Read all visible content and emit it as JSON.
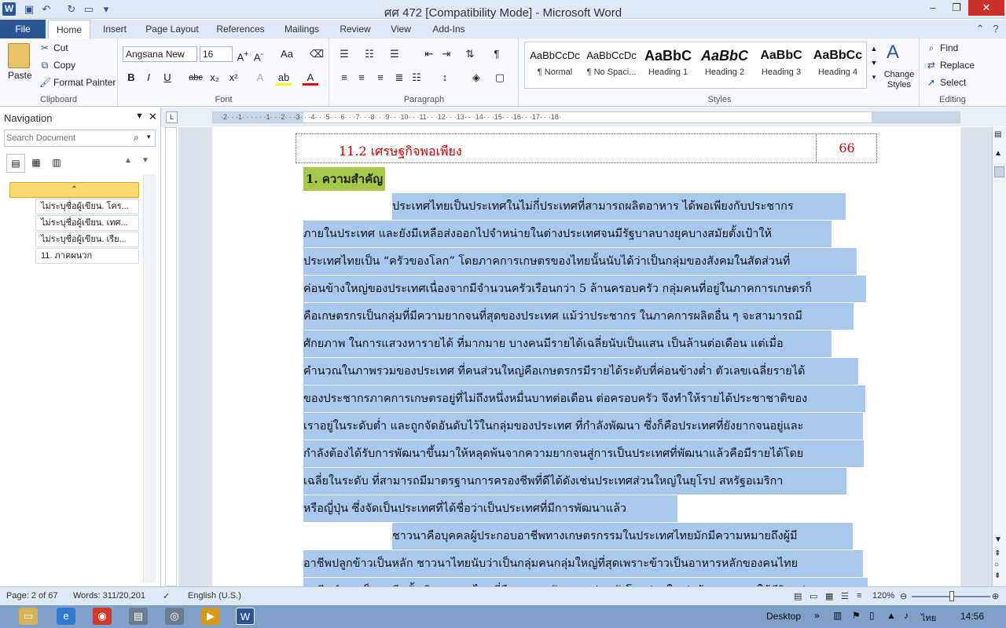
{
  "window": {
    "title": "ศศ 472 [Compatibility Mode]  -  Microsoft Word"
  },
  "tabs": {
    "file": "File",
    "items": [
      "Home",
      "Insert",
      "Page Layout",
      "References",
      "Mailings",
      "Review",
      "View",
      "Add-Ins"
    ]
  },
  "clipboard": {
    "paste": "Paste",
    "cut": "Cut",
    "copy": "Copy",
    "format_painter": "Format Painter",
    "label": "Clipboard"
  },
  "font": {
    "name": "Angsana New",
    "size": "16",
    "label": "Font"
  },
  "paragraph": {
    "label": "Paragraph"
  },
  "styles": {
    "label": "Styles",
    "change": "Change Styles",
    "items": [
      {
        "preview": "AaBbCcDc",
        "name": "¶ Normal"
      },
      {
        "preview": "AaBbCcDc",
        "name": "¶ No Spaci..."
      },
      {
        "preview": "AaBbC",
        "name": "Heading 1"
      },
      {
        "preview": "AaBbC",
        "name": "Heading 2"
      },
      {
        "preview": "AaBbC",
        "name": "Heading 3"
      },
      {
        "preview": "AaBbCc",
        "name": "Heading 4"
      }
    ]
  },
  "editing": {
    "label": "Editing",
    "find": "Find",
    "replace": "Replace",
    "select": "Select"
  },
  "nav": {
    "title": "Navigation",
    "search_placeholder": "Search Document",
    "items": [
      "ไม่ระบุชื่อผู้เขียน. โคร...",
      "ไม่ระบุชื่อผู้เขียน. เทศ...",
      "ไม่ระบุชื่อผู้เขียน. เรีย...",
      "11. ภาคผนวก"
    ]
  },
  "document": {
    "toc_entry": {
      "title": "11.2 เศรษฐกิจพอเพียง",
      "page": "66"
    },
    "heading": "1. ความสำคัญ",
    "lines": [
      "ประเทศไทยเป็นประเทศในไม่กี่ประเทศที่สามารถผลิตอาหาร ได้พอเพียงกับประชากร",
      "ภายในประเทศ และยังมีเหลือส่งออกไปจำหน่ายในต่างประเทศจนมีรัฐบาลบางยุคบางสมัยตั้งเป้าให้",
      "ประเทศไทยเป็น “ครัวของโลก”  โดยภาคการเกษตรของไทยนั้นนับได้ว่าเป็นกลุ่มของสังคมในสัดส่วนที่",
      "ค่อนข้างใหญ่ของประเทศเนื่องจากมีจำนวนครัวเรือนกว่า 5 ล้านครอบครัว กลุ่มคนที่อยู่ในภาคการเกษตรก็",
      "คือเกษตรกรเป็นกลุ่มที่มีความยากจนที่สุดของประเทศ แม้ว่าประชากร ในภาคการผลิตอื่น ๆ จะสามารถมี",
      "ศักยภาพ ในการแสวงหารายได้ ที่มากมาย บางคนมีรายได้เฉลี่ยนับเป็นแสน เป็นล้านต่อเดือน แต่เมื่อ",
      "คำนวณในภาพรวมของประเทศ ที่คนส่วนใหญ่คือเกษตรกรมีรายได้ระดับที่ค่อนข้างต่ำ ตัวเลขเฉลี่ยรายได้",
      "ของประชากรภาคการเกษตรอยู่ที่ไม่ถึงหนึ่งหมื่นบาทต่อเดือน ต่อครอบครัว จึงทำให้รายได้ประชาชาติของ",
      "เราอยู่ในระดับต่ำ และถูกจัดอันดับไว้ในกลุ่มของประเทศ ที่กำลังพัฒนา ซึ่งก็คือประเทศที่ยังยากจนอยู่และ",
      "กำลังต้องได้รับการพัฒนาขึ้นมาให้หลุดพ้นจากความยากจนสู่การเป็นประเทศที่พัฒนาแล้วคือมีรายได้โดย",
      "เฉลี่ยในระดับ ที่สามารถมีมาตรฐานการครองชีพที่ดีได้ดังเช่นประเทศส่วนใหญ่ในยุโรป สหรัฐอเมริกา",
      "หรือญี่ปุ่น ซึ่งจัดเป็นประเทศที่ได้ชื่อว่าเป็นประเทศที่มีการพัฒนาแล้ว",
      "ชาวนาคือบุคคลผู้ประกอบอาชีพทางเกษตรกรรมในประเทศไทยมักมีความหมายถึงผู้มี",
      "อาชีพปลูกข้าวเป็นหลัก ชาวนาไทยนับว่าเป็นกลุ่มคนกลุ่มใหญ่ที่สุดเพราะข้าวเป็นอาหารหลักของคนไทย",
      "อาชีพทำนาเป็นอาชีพดั้งเดิมของคนไทยที่สืบทอดมายังอนุชนรุ่นหลังโดยส่วนใหญ่แล้วชาวนาจะใช้ชีวิตอยู่"
    ]
  },
  "status": {
    "page": "Page: 2 of 67",
    "words": "Words: 311/20,201",
    "language": "English (U.S.)",
    "zoom": "120%"
  },
  "taskbar": {
    "desktop": "Desktop",
    "lang": "ไทย",
    "time": "14:56"
  }
}
